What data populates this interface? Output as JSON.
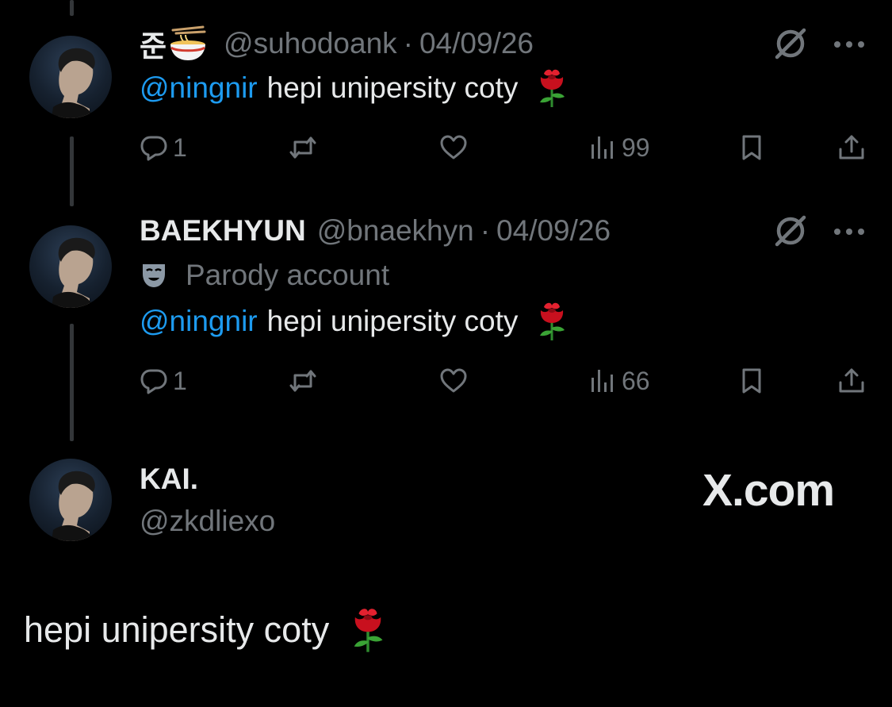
{
  "tweets": [
    {
      "display_name": "준",
      "name_emoji": "noodle-bowl",
      "handle": "@suhodoank",
      "separator": "·",
      "date": "04/09/26",
      "mention": "@ningnir",
      "text": "hepi unipersity coty",
      "text_emoji": "rose",
      "replies": "1",
      "views": "99"
    },
    {
      "display_name": "BAEKHYUN",
      "handle": "@bnaekhyn",
      "separator": "·",
      "date": "04/09/26",
      "parody_label": "Parody account",
      "mention": "@ningnir",
      "text": "hepi unipersity coty",
      "text_emoji": "rose",
      "replies": "1",
      "views": "66"
    }
  ],
  "quoted": {
    "display_name": "KAI.",
    "handle": "@zkdliexo",
    "brand": "X.com",
    "text": "hepi unipersity coty",
    "text_emoji": "rose"
  },
  "colors": {
    "background": "#000000",
    "text": "#e7e9ea",
    "muted": "#71767b",
    "mention": "#1d9bf0",
    "thread_line": "#333639"
  }
}
